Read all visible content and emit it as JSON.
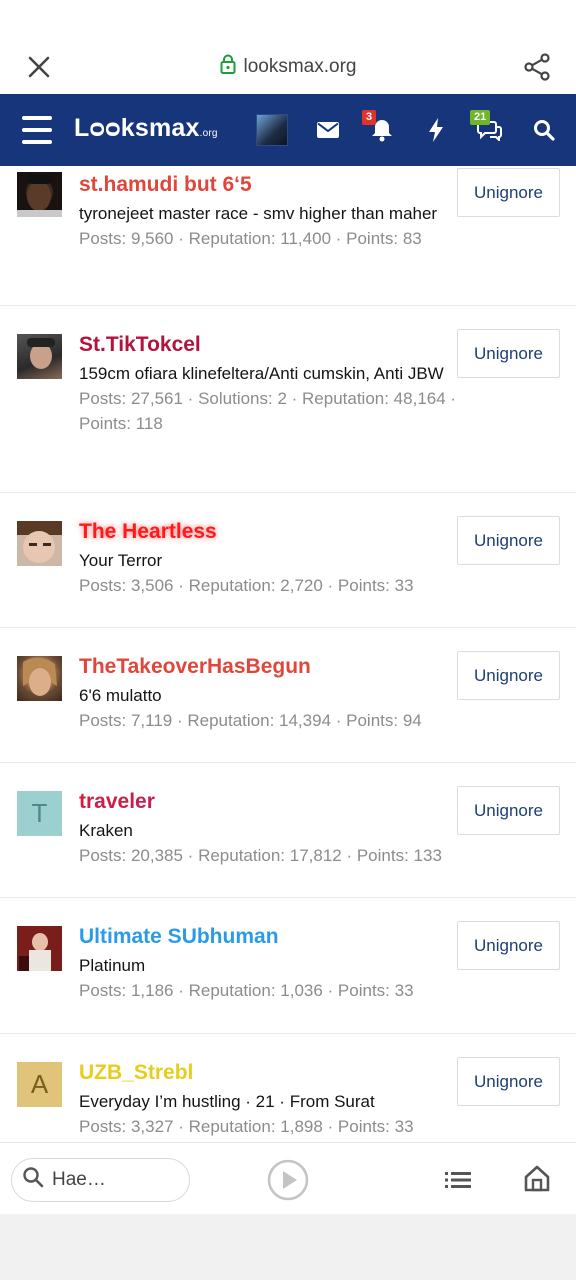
{
  "browser": {
    "url": "looksmax.org",
    "icons": {
      "close": "close-icon",
      "lock": "lock-icon",
      "share": "share-icon"
    }
  },
  "header": {
    "logo_main": "Lᴑᴑksmax",
    "logo_suffix": ".org",
    "notifications_count": "3",
    "conversations_count": "21",
    "colors": {
      "bar": "#16357a",
      "alert_badge": "#e0342a",
      "conversation_badge": "#6fb629"
    }
  },
  "members": [
    {
      "name": "st.hamudi but 6‘5",
      "name_color": "#e0463a",
      "title": "tyronejeet master race - smv higher than maher",
      "stats": "Posts: 9,560 · Reputation: 11,400 · Points: 83",
      "button": "Unignore",
      "avatar": "photo"
    },
    {
      "name": "St.TikTokcel",
      "name_color": "#b3123c",
      "title": "159cm ofiara klinefeltera/Anti cumskin, Anti JBW",
      "stats": "Posts: 27,561 · Solutions: 2 · Reputation: 48,164 · Points: 118",
      "button": "Unignore",
      "avatar": "photo"
    },
    {
      "name": "The Heartless",
      "name_color": "#ff1a1a",
      "title": "Your Terror",
      "stats": "Posts: 3,506 · Reputation: 2,720 · Points: 33",
      "button": "Unignore",
      "avatar": "photo"
    },
    {
      "name": "TheTakeoverHasBegun",
      "name_color": "#e0463a",
      "title": "6'6 mulatto",
      "stats": "Posts: 7,119 · Reputation: 14,394 · Points: 94",
      "button": "Unignore",
      "avatar": "photo"
    },
    {
      "name": "traveler",
      "name_color": "#b3123c",
      "title": "Kraken",
      "stats": "Posts: 20,385 · Reputation: 17,812 · Points: 133",
      "button": "Unignore",
      "avatar": "letter",
      "letter": "T",
      "letter_bg": "#9cd0d0",
      "letter_color": "#4f8a8a"
    },
    {
      "name": "Ultimate SUbhuman",
      "name_color": "#2b9be8",
      "title": "Platinum",
      "stats": "Posts: 1,186 · Reputation: 1,036 · Points: 33",
      "button": "Unignore",
      "avatar": "photo"
    },
    {
      "name": "UZB_Strebl",
      "name_color": "#e6cd1e",
      "title": "Everyday I’m hustling · 21 · From Surat",
      "stats": "Posts: 3,327 · Reputation: 1,898 · Points: 33",
      "button": "Unignore",
      "avatar": "letter",
      "letter": "A",
      "letter_bg": "#e0c47a",
      "letter_color": "#7b5e1e"
    }
  ],
  "bottom_bar": {
    "search_placeholder": "Hae…",
    "icons": {
      "search": "search-icon",
      "play": "play-icon",
      "list": "list-icon",
      "home": "home-icon"
    }
  }
}
